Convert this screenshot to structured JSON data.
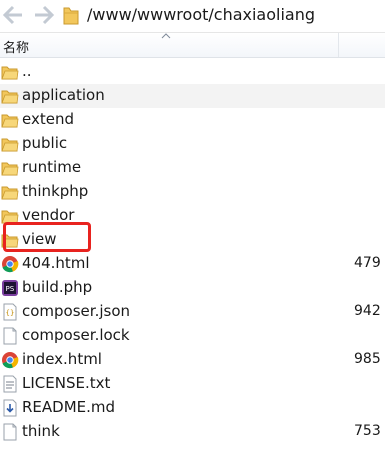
{
  "path": {
    "text": "/www/wwwroot/chaxiaoliang"
  },
  "header": {
    "name_label": "名称"
  },
  "rows": [
    {
      "name": "..",
      "type": "folder",
      "size": ""
    },
    {
      "name": "application",
      "type": "folder",
      "size": ""
    },
    {
      "name": "extend",
      "type": "folder",
      "size": ""
    },
    {
      "name": "public",
      "type": "folder",
      "size": ""
    },
    {
      "name": "runtime",
      "type": "folder",
      "size": ""
    },
    {
      "name": "thinkphp",
      "type": "folder",
      "size": ""
    },
    {
      "name": "vendor",
      "type": "folder",
      "size": ""
    },
    {
      "name": "view",
      "type": "folder",
      "size": ""
    },
    {
      "name": "404.html",
      "type": "chrome",
      "size": "479"
    },
    {
      "name": "build.php",
      "type": "php",
      "size": ""
    },
    {
      "name": "composer.json",
      "type": "json",
      "size": "942"
    },
    {
      "name": "composer.lock",
      "type": "file",
      "size": ""
    },
    {
      "name": "index.html",
      "type": "chrome",
      "size": "985"
    },
    {
      "name": "LICENSE.txt",
      "type": "text",
      "size": ""
    },
    {
      "name": "README.md",
      "type": "markdown",
      "size": ""
    },
    {
      "name": "think",
      "type": "file",
      "size": "753"
    }
  ],
  "colors": {
    "highlight": "#e8231f",
    "folder": "#e8b84a"
  }
}
